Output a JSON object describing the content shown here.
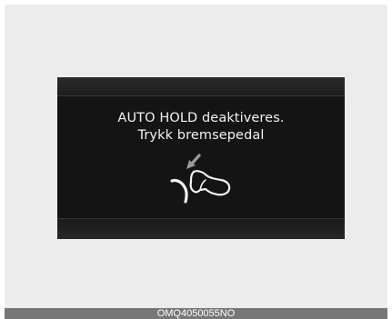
{
  "display": {
    "line1": "AUTO HOLD deaktiveres.",
    "line2": "Trykk bremsepedal"
  },
  "icon": {
    "name": "brake-pedal-press-icon"
  },
  "caption": "OMQ4050055NO",
  "colors": {
    "screen": "#141414",
    "text": "#f2f2f2",
    "arrow": "#9a9a9a",
    "caption_bar": "#777777",
    "background": "#ececec"
  }
}
